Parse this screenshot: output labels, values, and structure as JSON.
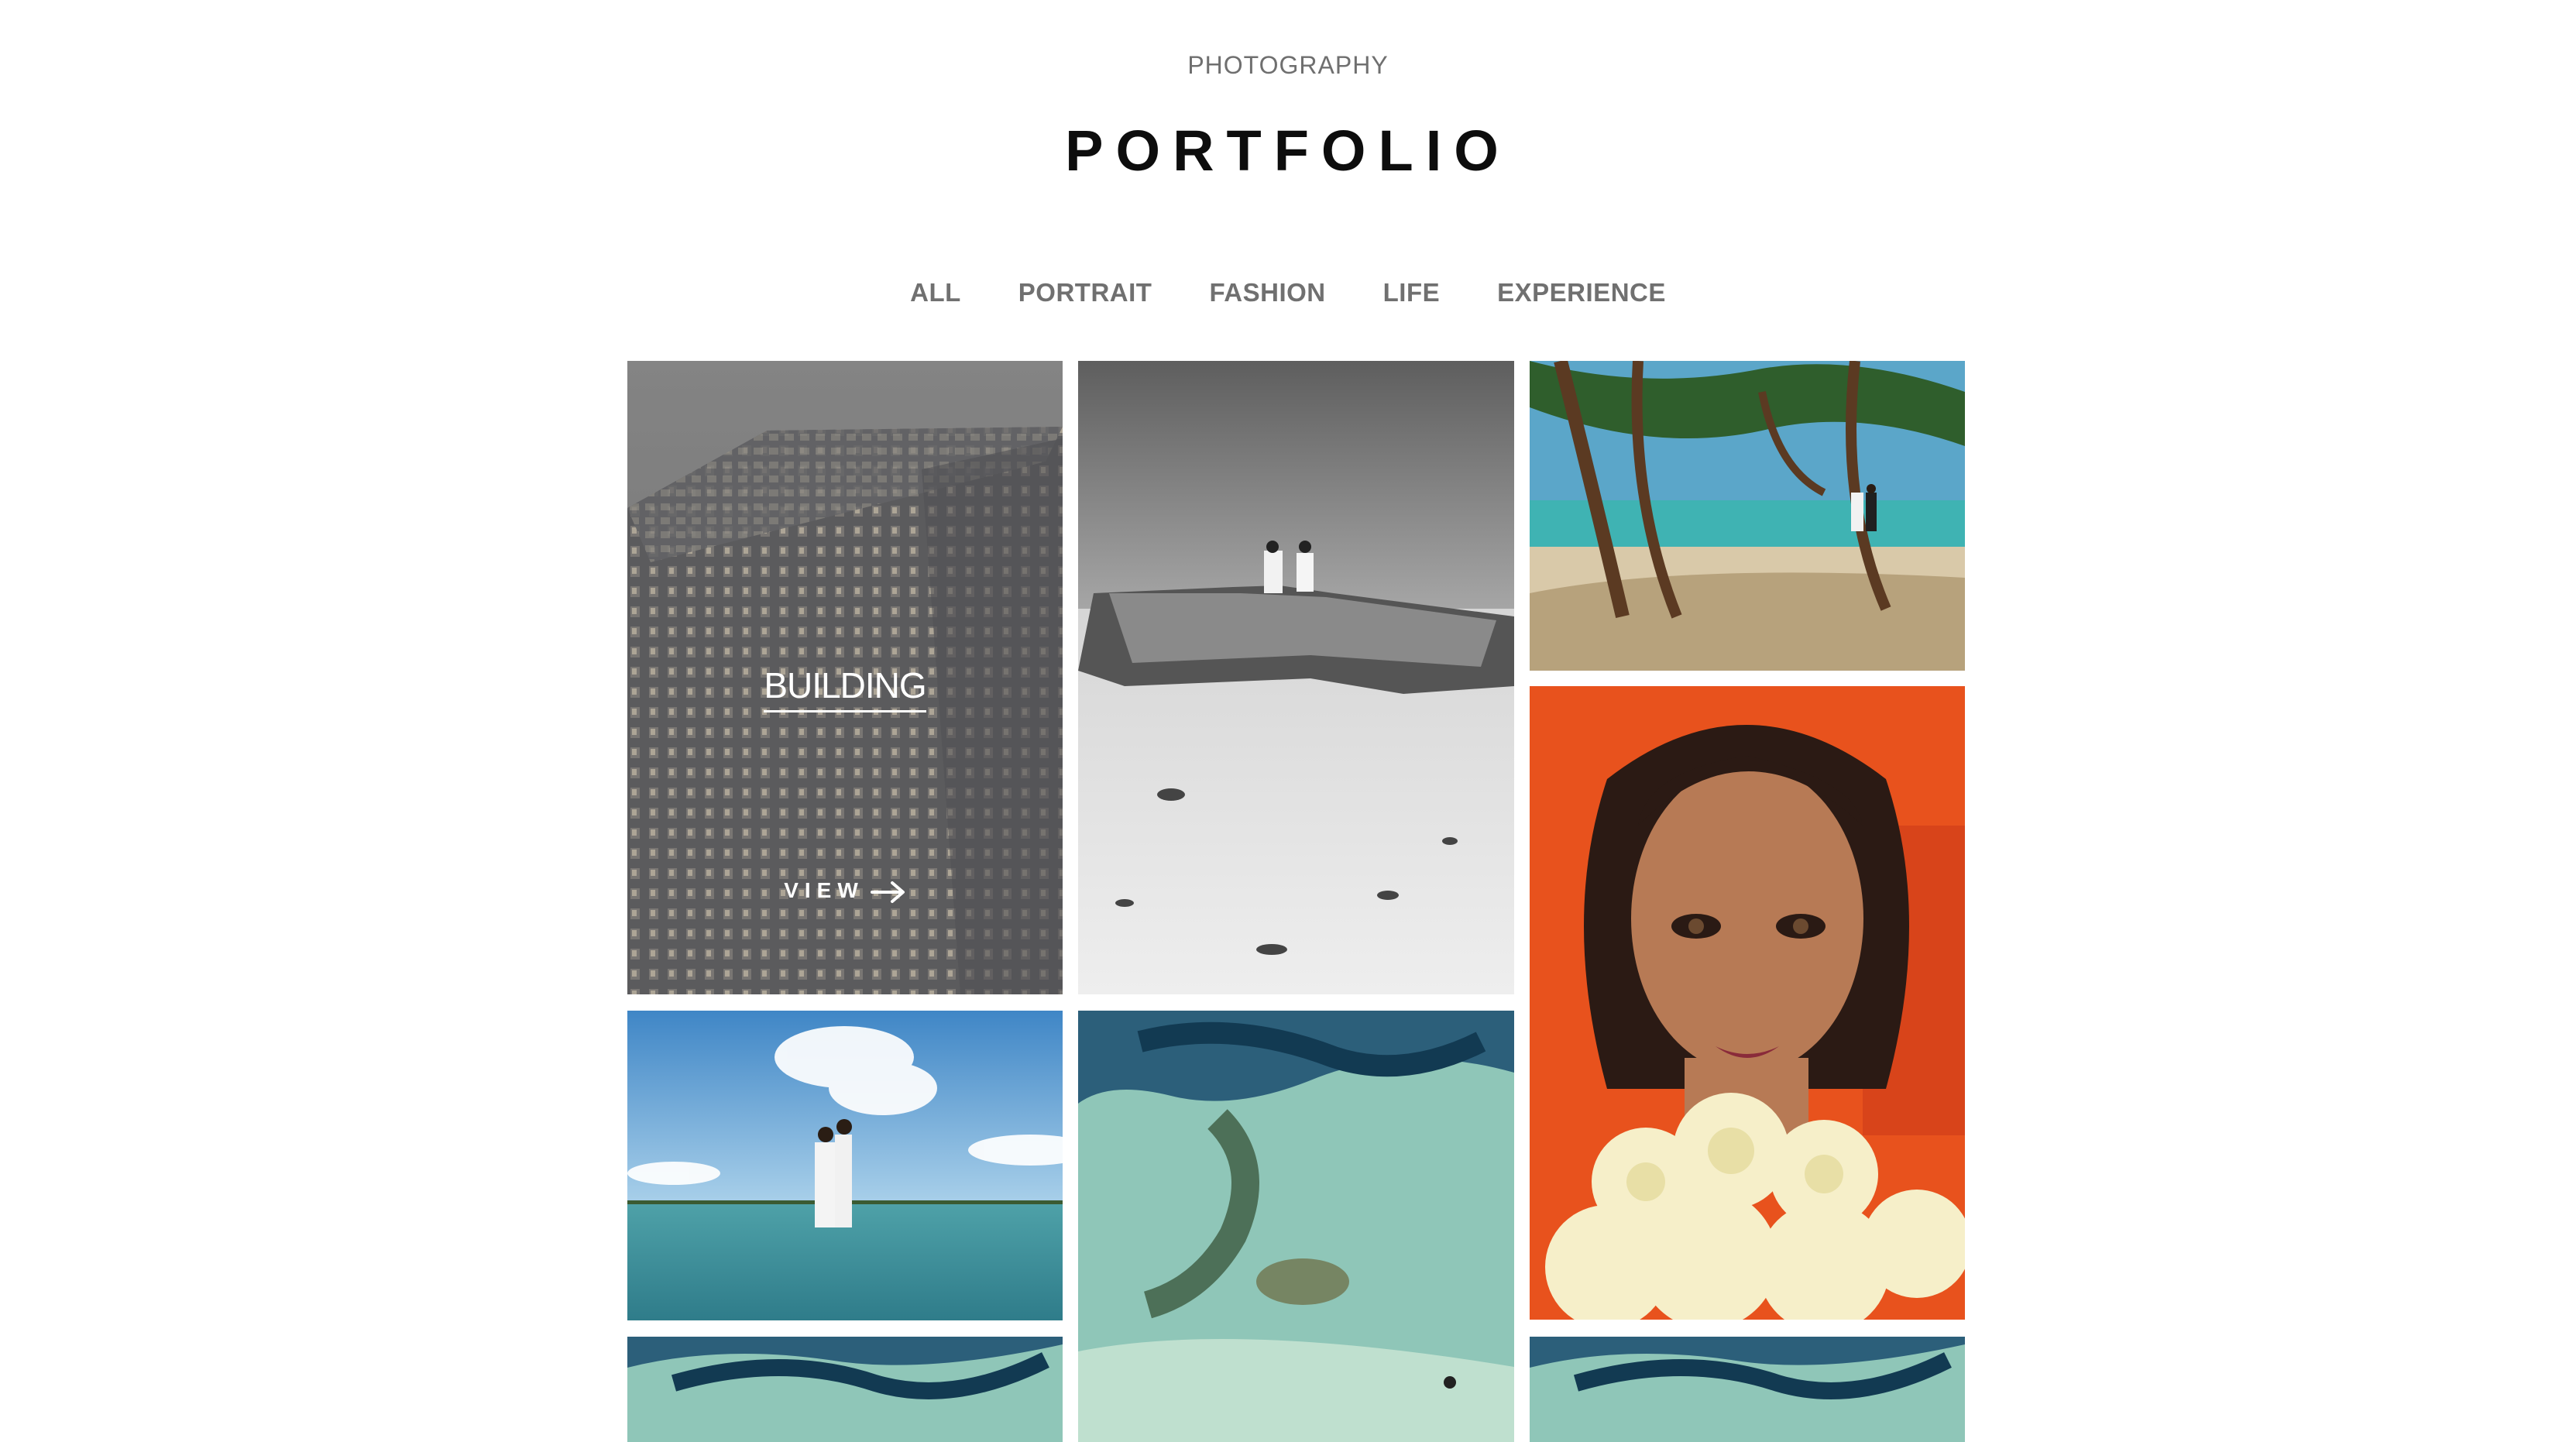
{
  "header": {
    "eyebrow": "PHOTOGRAPHY",
    "title": "PORTFOLIO"
  },
  "filters": [
    {
      "label": "ALL"
    },
    {
      "label": "PORTRAIT"
    },
    {
      "label": "FASHION"
    },
    {
      "label": "LIFE"
    },
    {
      "label": "EXPERIENCE"
    }
  ],
  "gallery": {
    "hover_item": {
      "title": "BUILDING",
      "view_label": "VIEW",
      "icon": "arrow-right-icon"
    },
    "items": [
      {
        "subject": "building"
      },
      {
        "subject": "couple-on-boat-wreck"
      },
      {
        "subject": "couple-under-trees-beach"
      },
      {
        "subject": "bride-with-bouquet"
      },
      {
        "subject": "couple-in-water"
      },
      {
        "subject": "aerial-reef"
      },
      {
        "subject": "aerial-reef"
      },
      {
        "subject": "aerial-reef"
      }
    ]
  }
}
